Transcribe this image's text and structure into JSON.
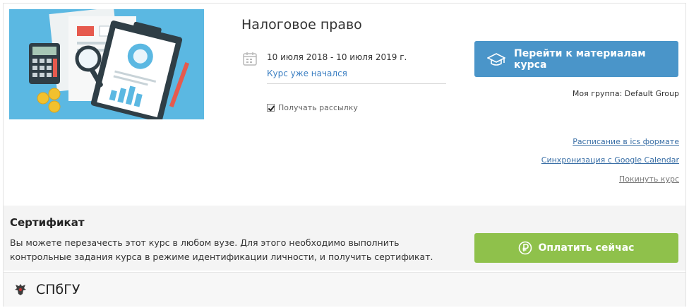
{
  "course": {
    "title": "Налоговое право",
    "dates": "10 июля 2018 - 10 июля 2019 г.",
    "status": "Курс уже начался",
    "subscribe_label": "Получать рассылку",
    "subscribe_checked": true
  },
  "actions": {
    "go_label": "Перейти к материалам курса",
    "group": "Моя группа: Default Group",
    "links": {
      "ics": "Расписание в ics формате",
      "google": "Синхронизация с Google Calendar",
      "leave": "Покинуть курс"
    }
  },
  "certificate": {
    "title": "Сертификат",
    "text": "Вы можете перезачесть этот курс в любом вузе. Для этого необходимо выполнить контрольные задания курса в режиме идентификации личности, и получить сертификат.",
    "pay_label": "Оплатить сейчас"
  },
  "university": {
    "name": "СПбГУ"
  },
  "colors": {
    "primary_button": "#4a95c9",
    "pay_button": "#8fc14b",
    "link": "#3a6fa6",
    "image_bg": "#5bb8e2"
  },
  "icons": {
    "calendar": "calendar-icon",
    "graduation": "graduation-cap-icon",
    "ruble": "ruble-icon",
    "university_logo": "eagle-logo-icon"
  }
}
